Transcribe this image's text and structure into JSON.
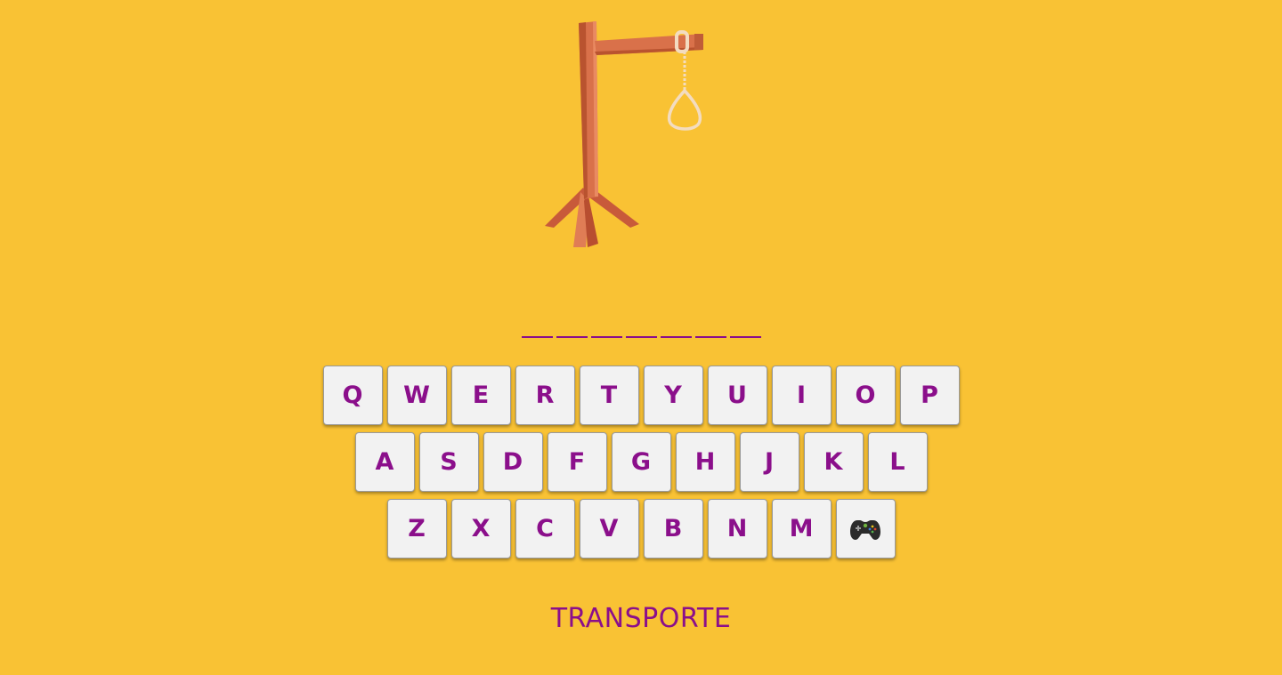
{
  "colors": {
    "background": "#f9c234",
    "accent": "#8b0f8b",
    "key_background": "#f2f2f2",
    "wood": "#d9714a",
    "rope": "#f3dcc0"
  },
  "word": {
    "slot_count": 7
  },
  "keyboard": {
    "rows": [
      [
        "Q",
        "W",
        "E",
        "R",
        "T",
        "Y",
        "U",
        "I",
        "O",
        "P"
      ],
      [
        "A",
        "S",
        "D",
        "F",
        "G",
        "H",
        "J",
        "K",
        "L"
      ],
      [
        "Z",
        "X",
        "C",
        "V",
        "B",
        "N",
        "M"
      ]
    ],
    "extra_key_icon": "gamepad-icon"
  },
  "category": "TRANSPORTE"
}
